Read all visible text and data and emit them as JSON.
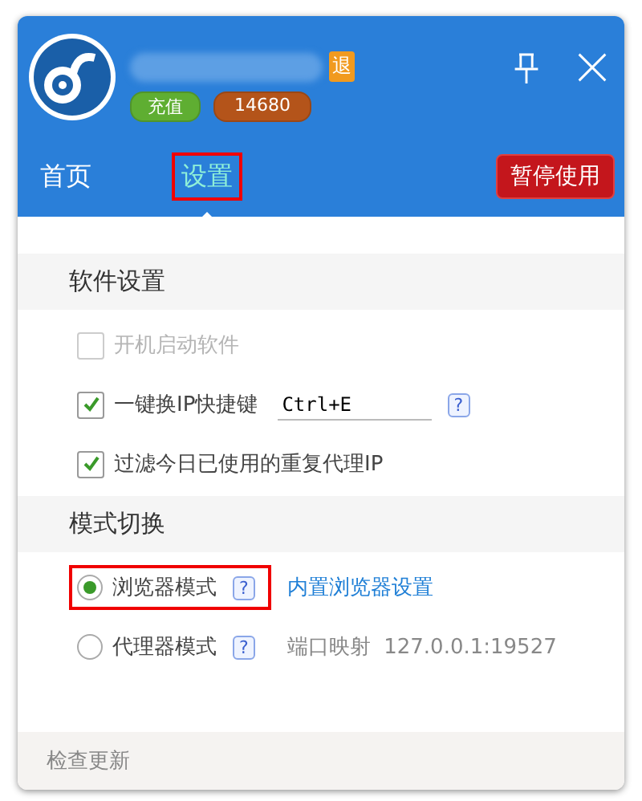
{
  "header": {
    "logout_badge": "退",
    "recharge_button": "充值",
    "balance": "14680",
    "pause_button": "暂停使用"
  },
  "tabs": [
    {
      "label": "首页",
      "selected": false,
      "highlighted": false
    },
    {
      "label": "设置",
      "selected": true,
      "highlighted": true
    }
  ],
  "sections": [
    {
      "title": "软件设置",
      "kind": "checkboxes",
      "items": [
        {
          "label": "开机启动软件",
          "checked": false,
          "disabled": true
        },
        {
          "label": "一键换IP快捷键",
          "checked": true,
          "disabled": false,
          "hotkey": "Ctrl+E",
          "help": "?"
        },
        {
          "label": "过滤今日已使用的重复代理IP",
          "checked": true,
          "disabled": false
        }
      ]
    },
    {
      "title": "模式切换",
      "kind": "radios",
      "items": [
        {
          "label": "浏览器模式",
          "selected": true,
          "highlighted": true,
          "help": "?",
          "link": "内置浏览器设置"
        },
        {
          "label": "代理器模式",
          "selected": false,
          "highlighted": false,
          "help": "?",
          "note": "端口映射  127.0.0.1:19527"
        }
      ]
    }
  ],
  "footer": {
    "link": "检查更新"
  }
}
